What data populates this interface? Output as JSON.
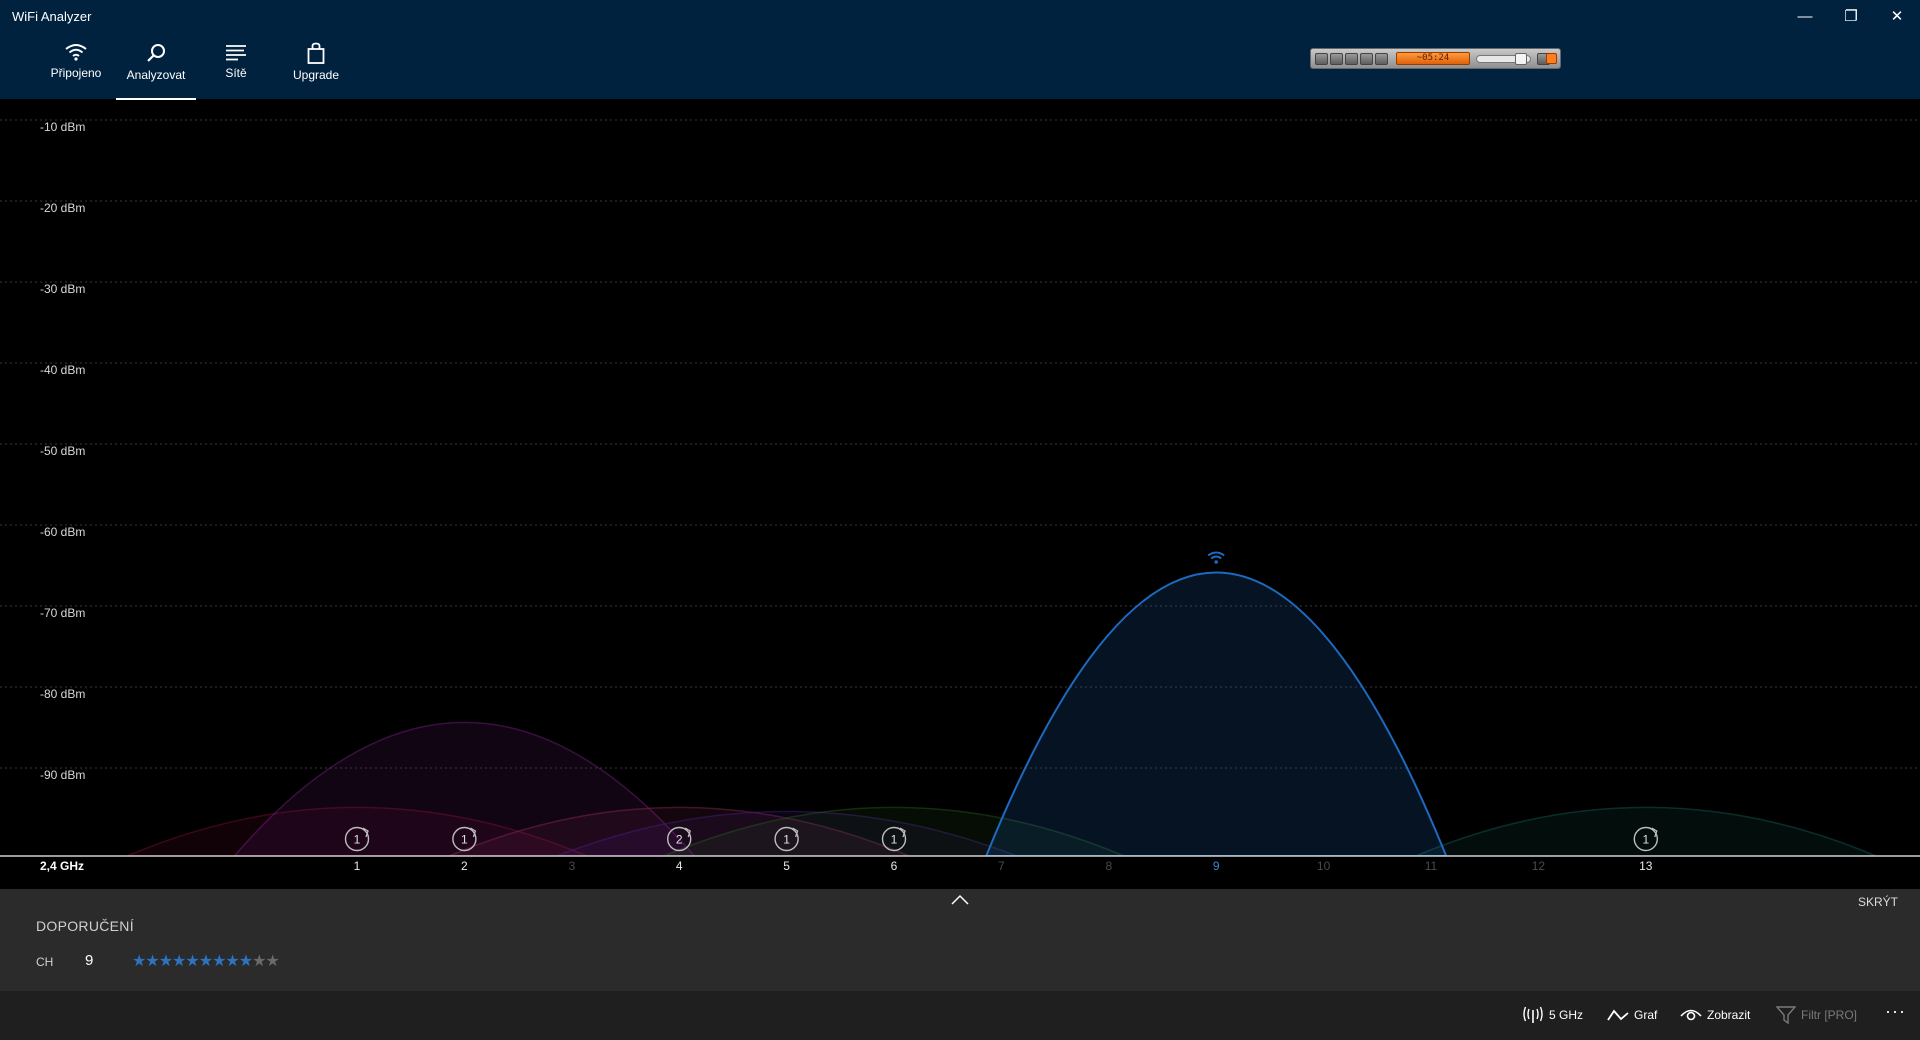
{
  "window": {
    "title": "WiFi Analyzer",
    "minimize_glyph": "—",
    "restore_glyph": "❐",
    "close_glyph": "✕"
  },
  "nav": {
    "items": [
      {
        "label": "Připojeno",
        "icon": "wifi-icon"
      },
      {
        "label": "Analyzovat",
        "icon": "analyze-search-icon",
        "active": true
      },
      {
        "label": "Sítě",
        "icon": "list-icon"
      },
      {
        "label": "Upgrade",
        "icon": "shopping-bag-icon"
      }
    ]
  },
  "player": {
    "display_text": "~05:24"
  },
  "chart_data": {
    "type": "area",
    "band_label": "2,4 GHz",
    "y_ticks": [
      "-10 dBm",
      "-20 dBm",
      "-30 dBm",
      "-40 dBm",
      "-50 dBm",
      "-60 dBm",
      "-70 dBm",
      "-80 dBm",
      "-90 dBm"
    ],
    "x_ticks": [
      "1",
      "2",
      "3",
      "4",
      "5",
      "6",
      "7",
      "8",
      "9",
      "10",
      "11",
      "12",
      "13"
    ],
    "active_channels": [
      "1",
      "2",
      "4",
      "5",
      "6",
      "9",
      "13"
    ],
    "highlight_channel": "9",
    "ylim": [
      -100,
      -5
    ],
    "networks": [
      {
        "channel": 1,
        "signal_dbm": -94,
        "color": "#7a1030"
      },
      {
        "channel": 2,
        "signal_dbm": -83.5,
        "color": "#7a1f86"
      },
      {
        "channel": 4,
        "signal_dbm": -94,
        "color": "#8a2a58"
      },
      {
        "channel": 5,
        "signal_dbm": -94.5,
        "color": "#4a2080"
      },
      {
        "channel": 6,
        "signal_dbm": -94,
        "color": "#2a5a20"
      },
      {
        "channel": 9,
        "signal_dbm": -65,
        "color": "#1e6ac0",
        "connected": true
      },
      {
        "channel": 13,
        "signal_dbm": -94,
        "color": "#126055"
      }
    ],
    "channel_badges": [
      {
        "channel": 1,
        "count": "1"
      },
      {
        "channel": 2,
        "count": "1"
      },
      {
        "channel": 4,
        "count": "2"
      },
      {
        "channel": 5,
        "count": "1"
      },
      {
        "channel": 6,
        "count": "1"
      },
      {
        "channel": 13,
        "count": "1"
      }
    ]
  },
  "recommendation": {
    "title": "DOPORUČENÍ",
    "ch_label": "CH",
    "ch_value": "9",
    "rating": 9,
    "rating_max": 11,
    "hide_label": "SKRÝT"
  },
  "commands": {
    "band": "5 GHz",
    "graph": "Graf",
    "view": "Zobrazit",
    "filter": "Filtr [PRO]",
    "more": "···"
  }
}
